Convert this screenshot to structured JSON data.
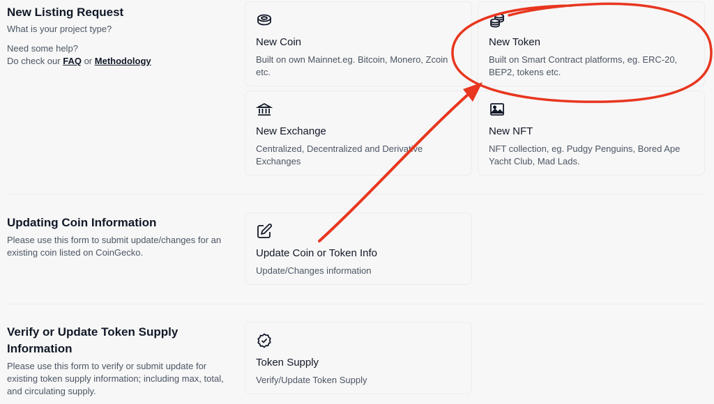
{
  "listing": {
    "title": "New Listing Request",
    "subtitle": "What is your project type?",
    "help_line": "Need some help?",
    "help_prefix": "Do check our",
    "faq": "FAQ",
    "or": "or",
    "methodology": "Methodology",
    "cards": [
      {
        "icon": "coin-icon",
        "title": "New Coin",
        "desc": "Built on own Mainnet.eg. Bitcoin, Monero, Zcoin etc."
      },
      {
        "icon": "coins-stack-icon",
        "title": "New Token",
        "desc": "Built on Smart Contract platforms, eg. ERC-20, BEP2, tokens etc."
      },
      {
        "icon": "bank-icon",
        "title": "New Exchange",
        "desc": "Centralized, Decentralized and Derivative Exchanges"
      },
      {
        "icon": "image-icon",
        "title": "New NFT",
        "desc": "NFT collection, eg. Pudgy Penguins, Bored Ape Yacht Club, Mad Lads."
      }
    ]
  },
  "update": {
    "title": "Updating Coin Information",
    "desc": "Please use this form to submit update/changes for an existing coin listed on CoinGecko.",
    "card": {
      "icon": "edit-icon",
      "title": "Update Coin or Token Info",
      "desc": "Update/Changes information"
    }
  },
  "supply": {
    "title": "Verify or Update Token Supply Information",
    "desc": "Please use this form to verify or submit update for existing token supply information; including max, total, and circulating supply.",
    "card": {
      "icon": "verified-badge-icon",
      "title": "Token Supply",
      "desc": "Verify/Update Token Supply"
    }
  },
  "annotation": {
    "color": "#e8361f"
  }
}
